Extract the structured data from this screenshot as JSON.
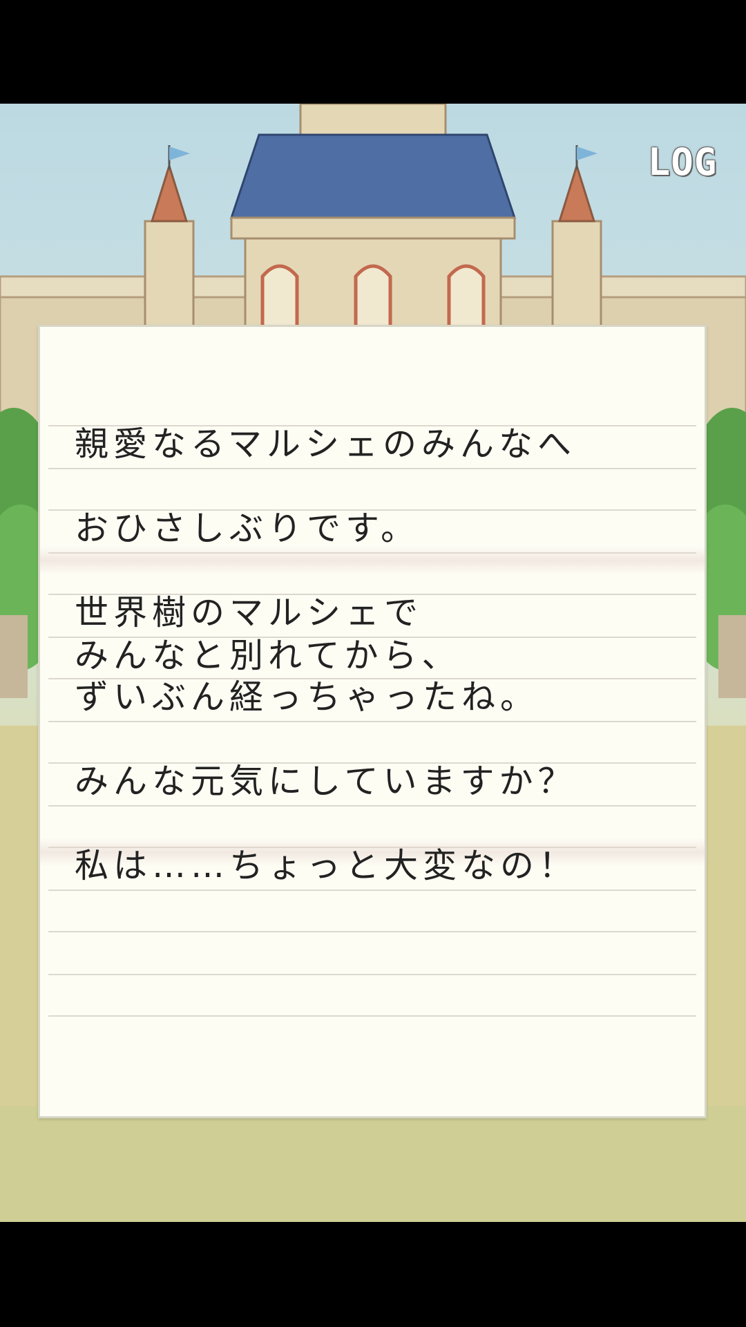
{
  "header": {
    "log_label": "LOG"
  },
  "letter": {
    "lines": [
      "親愛なるマルシェのみんなへ",
      "おひさしぶりです。",
      "世界樹のマルシェで",
      "みんなと別れてから、",
      "ずいぶん経っちゃったね。",
      "みんな元気にしていますか？",
      "私は……ちょっと大変なの！"
    ]
  },
  "colors": {
    "paper": "#fdfdf4",
    "ink": "#222222",
    "roof": "#4f6ea3",
    "sky": "#bcd9e2"
  }
}
